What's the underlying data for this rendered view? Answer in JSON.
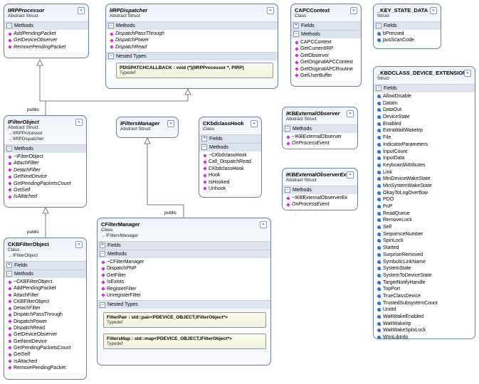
{
  "diagram": {
    "classes": {
      "iirp_processor": {
        "title": "IIRPProcessor",
        "kind": "Abstract Struct",
        "sections": {
          "methods": "Methods"
        },
        "methods": [
          "AddPendingPacket",
          "GetDeviceObserver",
          "RemovePendingPacket"
        ]
      },
      "iirp_dispatcher": {
        "title": "IIRPDispatcher",
        "kind": "Abstract Struct",
        "sections": {
          "methods": "Methods",
          "nested": "Nested Types"
        },
        "methods": [
          "DispatchPassThrough",
          "DispatchPower",
          "DispatchRead"
        ],
        "nested": [
          {
            "title": "PDISPATCHCALLBACK : void (*)(IIRPProcessor *, PIRP)",
            "kind": "Typedef"
          }
        ]
      },
      "capc_context": {
        "title": "CAPCContext",
        "kind": "Class",
        "sections": {
          "fields": "Fields",
          "methods": "Methods"
        },
        "methods": [
          "CAPCContext",
          "GetCurrentIRP",
          "GetObserver",
          "GetOriginalAPCContext",
          "GetOriginalAPCRoutine",
          "GetUserBuffer"
        ]
      },
      "key_state_data": {
        "title": "_KEY_STATE_DATA",
        "kind": "Struct",
        "sections": {
          "fields": "Fields"
        },
        "fields": [
          "bPressed",
          "pusScanCode"
        ]
      },
      "kbdclass_device_extension": {
        "title": "_KBDCLASS_DEVICE_EXTENSION",
        "kind": "Struct",
        "sections": {
          "fields": "Fields"
        },
        "fields": [
          "AllowDisable",
          "DataIn",
          "DataOut",
          "DeviceState",
          "Enabled",
          "ExtraWaitWakeIrp",
          "File",
          "IndicatorParameters",
          "InputCount",
          "InputData",
          "KeyboardAttributes",
          "Link",
          "MinDeviceWakeState",
          "MinSystemWakeState",
          "OkayToLogOverflow",
          "PDO",
          "PnP",
          "ReadQueue",
          "RemoveLock",
          "Self",
          "SequenceNumber",
          "SpinLock",
          "Started",
          "SurpriseRemoved",
          "SymbolicLinkName",
          "SystemState",
          "SystemToDeviceState",
          "TargetNotifyHandle",
          "TopPort",
          "TrueClassDevice",
          "TrustedSubsystemCount",
          "UnitId",
          "WaitWakeEnabled",
          "WaitWakeIrp",
          "WaitWakeSpinLock",
          "WmiLibInfo"
        ]
      },
      "ifilter_object": {
        "title": "IFilterObject",
        "kind": "Abstract Struct",
        "inherits": [
          "IIRPProcessor",
          "IIRPDispatcher"
        ],
        "sections": {
          "methods": "Methods"
        },
        "methods": [
          "~IFilterObject",
          "AttachFilter",
          "DetachFilter",
          "GetNextDevice",
          "GetPendingPacketsCount",
          "GetSelf",
          "IsAttached"
        ]
      },
      "ifilters_manager": {
        "title": "IFiltersManager",
        "kind": "Abstract Struct"
      },
      "ckbdclass_hook": {
        "title": "CKbdclassHook",
        "kind": "Class",
        "sections": {
          "fields": "Fields",
          "methods": "Methods"
        },
        "methods": [
          "~CKbdclassHook",
          "Call_DispatchRead",
          "CKbdclassHook",
          "Hook",
          "IsHooked",
          "Unhook"
        ]
      },
      "ikb_external_observer": {
        "title": "IKBExternalObserver",
        "kind": "Abstract Struct",
        "sections": {
          "methods": "Methods"
        },
        "methods": [
          "~IKBExternalObserver",
          "OnProcessEvent"
        ]
      },
      "ikb_external_observer_ex": {
        "title": "IKBExternalObserverEx",
        "kind": "Abstract Struct",
        "sections": {
          "methods": "Methods"
        },
        "methods": [
          "~IKBExternalObserverEx",
          "OnProcessEvent"
        ]
      },
      "ckb_filter_object": {
        "title": "CKBFilterObject",
        "kind": "Class",
        "inherits": [
          "IFilterObject"
        ],
        "sections": {
          "fields": "Fields",
          "methods": "Methods"
        },
        "methods": [
          "~CKBFilterObject",
          "AddPendingPacket",
          "AttachFilter",
          "CKBFilterObject",
          "DetachFilter",
          "DispatchPassThrough",
          "DispatchPower",
          "DispatchRead",
          "GetDeviceObserver",
          "GetNextDevice",
          "GetPendingPacketsCount",
          "GetSelf",
          "IsAttached",
          "RemovePendingPacket"
        ]
      },
      "cfilter_manager": {
        "title": "CFilterManager",
        "kind": "Class",
        "inherits": [
          "IFiltersManager"
        ],
        "sections": {
          "fields": "Fields",
          "methods": "Methods",
          "nested": "Nested Types"
        },
        "methods": [
          "~CFilterManager",
          "DispatchPNP",
          "GetFilter",
          "IsExists",
          "RegisterFilter",
          "UnregisterFilter"
        ],
        "nested": [
          {
            "title": "FilterPair : std::pair<PDEVICE_OBJECT,IFilterObject*>",
            "kind": "Typedef"
          },
          {
            "title": "FiltersMap : std::map<PDEVICE_OBJECT,IFilterObject*>",
            "kind": "Typedef"
          }
        ]
      }
    },
    "labels": {
      "public1": "public",
      "public2": "public",
      "public3": "public"
    }
  }
}
